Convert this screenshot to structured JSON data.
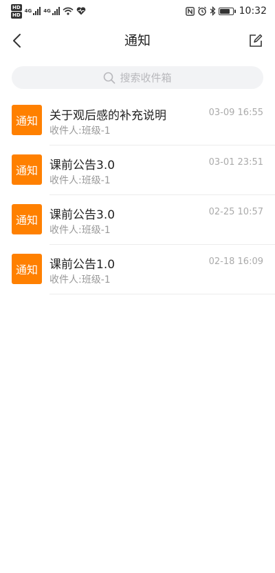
{
  "status_bar": {
    "hd_labels": [
      "HD",
      "HD"
    ],
    "network_labels": [
      "4G",
      "4G"
    ],
    "battery_level": 0.8,
    "time": "10:32"
  },
  "nav": {
    "title": "通知"
  },
  "search": {
    "placeholder": "搜索收件箱"
  },
  "notices": [
    {
      "badge": "通知",
      "title": "关于观后感的补充说明",
      "recipient": "收件人:班级-1",
      "time": "03-09 16:55"
    },
    {
      "badge": "通知",
      "title": "课前公告3.0",
      "recipient": "收件人:班级-1",
      "time": "03-01 23:51"
    },
    {
      "badge": "通知",
      "title": "课前公告3.0",
      "recipient": "收件人:班级-1",
      "time": "02-25 10:57"
    },
    {
      "badge": "通知",
      "title": "课前公告1.0",
      "recipient": "收件人:班级-1",
      "time": "02-18 16:09"
    }
  ],
  "colors": {
    "accent": "#ff8000",
    "search_bg": "#f2f3f5",
    "secondary_text": "#999999",
    "divider": "#ececec"
  }
}
